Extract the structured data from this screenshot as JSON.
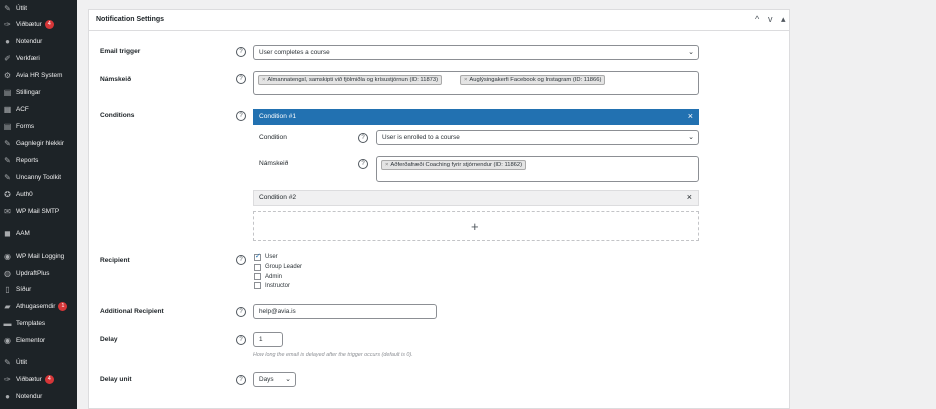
{
  "sidebar": {
    "items": [
      {
        "label": "Útlit",
        "icon": "brush-icon"
      },
      {
        "label": "Viðbætur",
        "icon": "plugin-icon",
        "badge": "4"
      },
      {
        "label": "Notendur",
        "icon": "users-icon"
      },
      {
        "label": "Verkfæri",
        "icon": "wrench-icon"
      },
      {
        "label": "Avia HR System",
        "icon": "gear-icon"
      },
      {
        "label": "Stillingar",
        "icon": "settings-icon"
      },
      {
        "label": "ACF",
        "icon": "grid-icon"
      },
      {
        "label": "Forms",
        "icon": "forms-icon"
      },
      {
        "label": "Gagnlegir hlekkir",
        "icon": "link-icon"
      },
      {
        "label": "Reports",
        "icon": "reports-icon"
      },
      {
        "label": "Uncanny Toolkit",
        "icon": "toolkit-icon"
      },
      {
        "label": "Auth0",
        "icon": "lock-icon"
      },
      {
        "label": "WP Mail SMTP",
        "icon": "mail-icon"
      },
      {
        "label": "AAM",
        "icon": "shield-icon"
      },
      {
        "label": "WP Mail Logging",
        "icon": "log-icon"
      },
      {
        "label": "UpdraftPlus",
        "icon": "backup-icon"
      },
      {
        "label": "Síður",
        "icon": "pages-icon"
      },
      {
        "label": "Athugasemdir",
        "icon": "comment-icon",
        "badge": "1"
      },
      {
        "label": "Templates",
        "icon": "templates-icon"
      },
      {
        "label": "Elementor",
        "icon": "elementor-icon"
      },
      {
        "label": "Útlit",
        "icon": "brush-icon"
      },
      {
        "label": "Viðbætur",
        "icon": "plugin-icon",
        "badge": "4"
      },
      {
        "label": "Notendur",
        "icon": "users-icon"
      }
    ]
  },
  "panel": {
    "title": "Notification Settings",
    "controls": [
      "^",
      "v",
      "▴"
    ]
  },
  "form": {
    "email_trigger": {
      "label": "Email trigger",
      "value": "User completes a course"
    },
    "namskeid": {
      "label": "Námskeið",
      "chips": [
        "Almannatengsl, samskipti við fjölmiðla og krísustjórnun (ID: 11873)",
        "Auglýsingakerfi Facebook og Instagram (ID: 11866)"
      ]
    },
    "conditions": {
      "label": "Conditions",
      "condition1": {
        "title": "Condition #1",
        "close": "×",
        "condition_label": "Condition",
        "condition_value": "User is enrolled to a course",
        "namskeid_label": "Námskeið",
        "namskeid_chip": "Aðferðafræði Coaching fyrir stjórnendur (ID: 11862)"
      },
      "condition2": {
        "title": "Condition #2",
        "close": "×"
      },
      "add": "+"
    },
    "recipient": {
      "label": "Recipient",
      "options": [
        {
          "label": "User",
          "checked": true
        },
        {
          "label": "Group Leader",
          "checked": false
        },
        {
          "label": "Admin",
          "checked": false
        },
        {
          "label": "Instructor",
          "checked": false
        }
      ]
    },
    "additional_recipient": {
      "label": "Additional Recipient",
      "value": "help@avia.is"
    },
    "delay": {
      "label": "Delay",
      "value": "1",
      "description": "How long the email is delayed after the trigger occurs (default is 0)."
    },
    "delay_unit": {
      "label": "Delay unit",
      "value": "Days"
    },
    "help_glyph": "?"
  },
  "colors": {
    "sidebar_bg": "#1d2327",
    "accent": "#2271b1",
    "badge": "#d63638"
  }
}
